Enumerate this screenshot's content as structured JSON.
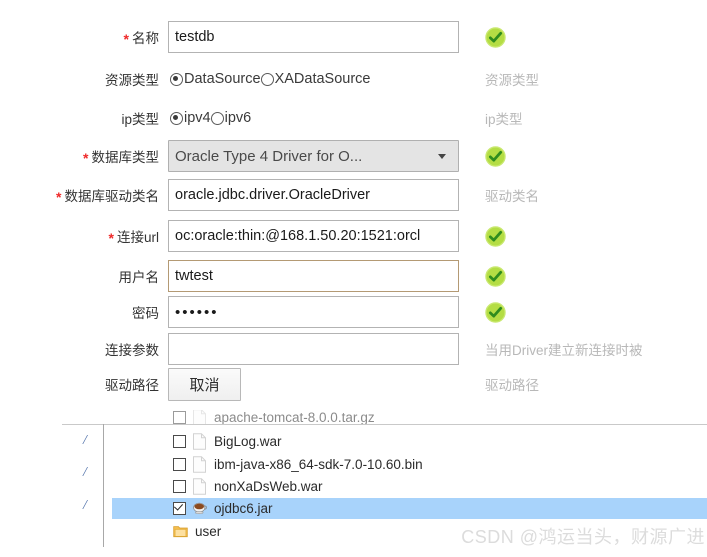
{
  "colors": {
    "required_asterisk": "#ef2929",
    "ok_badge_fill": "#b4dd44",
    "ok_badge_check": "#2f8c1e",
    "hint_text": "#b8b8b8",
    "selected_row": "#a8d3fb",
    "folder_icon": "#f5bd4b",
    "focused_border": "#b49a74",
    "slash_text": "#4d6fa8",
    "watermark": "#dcdcdc"
  },
  "form": {
    "rows": [
      {
        "label": "名称",
        "required": true,
        "control": "text",
        "value": "testdb",
        "placeholder": "",
        "focused": false,
        "status": "ok",
        "hint": ""
      },
      {
        "label": "资源类型",
        "required": false,
        "control": "radio",
        "options": [
          {
            "label": "DataSource",
            "selected": true
          },
          {
            "label": "XADataSource",
            "selected": false
          }
        ],
        "status": "hint",
        "hint": "资源类型"
      },
      {
        "label": "ip类型",
        "required": false,
        "control": "radio",
        "options": [
          {
            "label": "ipv4",
            "selected": true
          },
          {
            "label": "ipv6",
            "selected": false
          }
        ],
        "status": "hint",
        "hint": "ip类型"
      },
      {
        "label": "数据库类型",
        "required": true,
        "control": "select",
        "value": "Oracle Type 4 Driver for O...",
        "options": [
          "Oracle Type 4 Driver for O..."
        ],
        "status": "ok",
        "hint": ""
      },
      {
        "label": "数据库驱动类名",
        "required": true,
        "control": "text",
        "value": "oracle.jdbc.driver.OracleDriver",
        "placeholder": "",
        "focused": false,
        "status": "hint",
        "hint": "驱动类名"
      },
      {
        "label": "连接url",
        "required": true,
        "control": "text",
        "value": "oc:oracle:thin:@168.1.50.20:1521:orcl",
        "placeholder": "",
        "focused": false,
        "status": "ok",
        "hint": ""
      },
      {
        "label": "用户名",
        "required": false,
        "control": "text",
        "value": "twtest",
        "placeholder": "",
        "focused": true,
        "status": "ok",
        "hint": ""
      },
      {
        "label": "密码",
        "required": false,
        "control": "password",
        "value": "••••••",
        "placeholder": "",
        "focused": false,
        "status": "ok",
        "hint": ""
      },
      {
        "label": "连接参数",
        "required": false,
        "control": "text",
        "value": "",
        "placeholder": "",
        "focused": false,
        "status": "hint",
        "hint": "当用Driver建立新连接时被"
      },
      {
        "label": "驱动路径",
        "required": false,
        "control": "button",
        "button_label": "取消",
        "status": "hint",
        "hint": "驱动路径"
      }
    ]
  },
  "file_browser": {
    "path_column": [
      "/",
      "/",
      "/"
    ],
    "files": [
      {
        "name": "apache-tomcat-8.0.0.tar.gz",
        "icon": "file-icon",
        "checked": false,
        "selected": false,
        "clipped": true
      },
      {
        "name": "BigLog.war",
        "icon": "file-icon",
        "checked": false,
        "selected": false,
        "clipped": false
      },
      {
        "name": "ibm-java-x86_64-sdk-7.0-10.60.bin",
        "icon": "file-icon",
        "checked": false,
        "selected": false,
        "clipped": false
      },
      {
        "name": "nonXaDsWeb.war",
        "icon": "file-icon",
        "checked": false,
        "selected": false,
        "clipped": false
      },
      {
        "name": "ojdbc6.jar",
        "icon": "jar-coffee-icon",
        "checked": true,
        "selected": true,
        "clipped": false
      }
    ],
    "folder": {
      "name": "user",
      "icon": "folder-icon"
    }
  },
  "watermark": {
    "text": "CSDN @鸿运当头，财源广进"
  }
}
